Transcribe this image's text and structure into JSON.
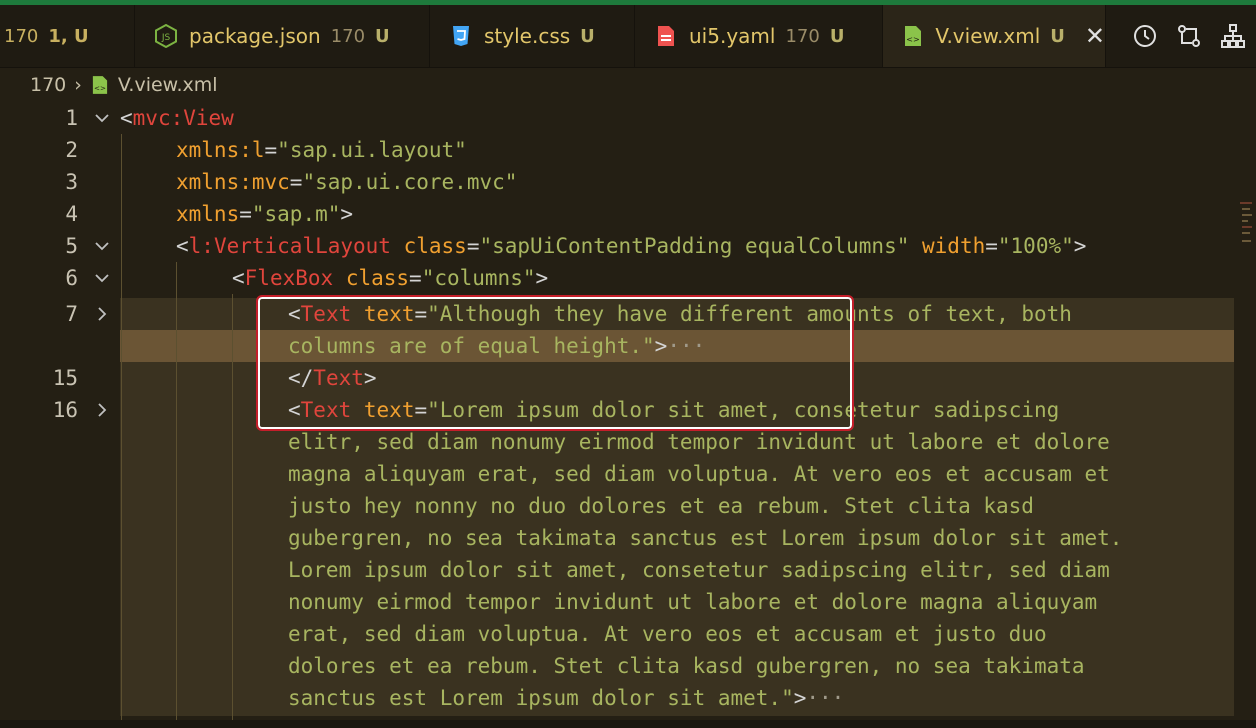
{
  "tabs": [
    {
      "name": "",
      "num": "170",
      "status": "1, U"
    },
    {
      "name": "package.json",
      "num": "170",
      "status": "U",
      "icon": "nodejs-icon"
    },
    {
      "name": "style.css",
      "num": "",
      "status": "U",
      "icon": "css-icon"
    },
    {
      "name": "ui5.yaml",
      "num": "170",
      "status": "U",
      "icon": "yaml-file-icon"
    },
    {
      "name": "V.view.xml",
      "num": "",
      "status": "U",
      "icon": "xml-file-icon",
      "close": "✕"
    }
  ],
  "breadcrumb": {
    "folder": "170",
    "file": "V.view.xml"
  },
  "lines": {
    "n1": "1",
    "n2": "2",
    "n3": "3",
    "n4": "4",
    "n5": "5",
    "n6": "6",
    "n7": "7",
    "n15": "15",
    "n16": "16"
  },
  "code": {
    "l1": {
      "tag": "mvc:View"
    },
    "l2": {
      "attr": "xmlns:l",
      "val": "\"sap.ui.layout\""
    },
    "l3": {
      "attr": "xmlns:mvc",
      "val": "\"sap.ui.core.mvc\""
    },
    "l4": {
      "attr": "xmlns",
      "val": "\"sap.m\""
    },
    "l5": {
      "tag": "l:VerticalLayout",
      "attr1": "class",
      "val1": "\"sapUiContentPadding equalColumns\"",
      "attr2": "width",
      "val2": "\"100%\""
    },
    "l6": {
      "tag": "FlexBox",
      "attr1": "class",
      "val1": "\"columns\""
    },
    "l7": {
      "tag": "Text",
      "attr1": "text",
      "val1a": "\"Although they have different amounts of text, both",
      "val1b": "columns are of equal height.\""
    },
    "l15": {
      "tag": "Text"
    },
    "l16": {
      "tag": "Text",
      "attr1": "text",
      "wrap": [
        "\"Lorem ipsum dolor sit amet, consetetur sadipscing",
        "elitr, sed diam nonumy eirmod tempor invidunt ut labore et dolore",
        "magna aliquyam erat, sed diam voluptua. At vero eos et accusam et",
        "justo hey nonny no duo dolores et ea rebum. Stet clita kasd",
        "gubergren, no sea takimata sanctus est Lorem ipsum dolor sit amet.",
        "Lorem ipsum dolor sit amet, consetetur sadipscing elitr, sed diam",
        "nonumy eirmod tempor invidunt ut labore et dolore magna aliquyam",
        "erat, sed diam voluptua. At vero eos et accusam et justo duo",
        "dolores et ea rebum. Stet clita kasd gubergren, no sea takimata",
        "sanctus est Lorem ipsum dolor sit amet.\""
      ]
    }
  },
  "ellipsis": "···",
  "colors": {
    "tag": "#e0453c",
    "attr": "#f0a030",
    "value": "#a8b560",
    "highlight_box": "#c41e2a"
  }
}
